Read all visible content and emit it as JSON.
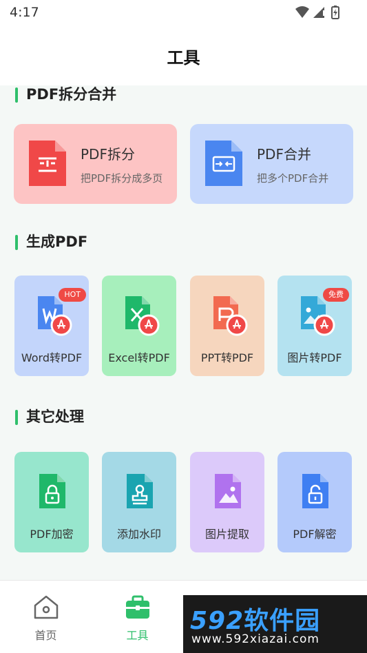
{
  "status_bar": {
    "time": "4:17"
  },
  "header": {
    "title": "工具"
  },
  "sections": {
    "split_merge": {
      "title": "PDF拆分合并"
    },
    "generate": {
      "title": "生成PDF"
    },
    "other": {
      "title": "其它处理"
    }
  },
  "big_cards": [
    {
      "name": "PDF拆分",
      "desc": "把PDF拆分成多页",
      "bg": "#fdc4c4",
      "icon_color": "#f04848"
    },
    {
      "name": "PDF合并",
      "desc": "把多个PDF合并",
      "bg": "#c6d8fc",
      "icon_color": "#4a86f0"
    }
  ],
  "generate_items": [
    {
      "label": "Word转PDF",
      "badge": "HOT",
      "bg": "#c3d5fb"
    },
    {
      "label": "Excel转PDF",
      "badge": "",
      "bg": "#a7efbc"
    },
    {
      "label": "PPT转PDF",
      "badge": "",
      "bg": "#f6d6be"
    },
    {
      "label": "图片转PDF",
      "badge": "免费",
      "bg": "#b4e2f0"
    }
  ],
  "other_items": [
    {
      "label": "PDF加密",
      "bg": "#97e6cd"
    },
    {
      "label": "添加水印",
      "bg": "#a4d9e6"
    },
    {
      "label": "图片提取",
      "bg": "#dccafa"
    },
    {
      "label": "PDF解密",
      "bg": "#b4cafb"
    }
  ],
  "bottom_nav": [
    {
      "label": "首页",
      "icon": "home-icon",
      "active": false
    },
    {
      "label": "工具",
      "icon": "toolbox-icon",
      "active": true
    }
  ],
  "watermark": {
    "brand_num": "592",
    "brand_cn": "软件园",
    "url": "www.592xiazai.com"
  },
  "colors": {
    "accent": "#2fbf6b",
    "badge": "#ef4a45"
  }
}
